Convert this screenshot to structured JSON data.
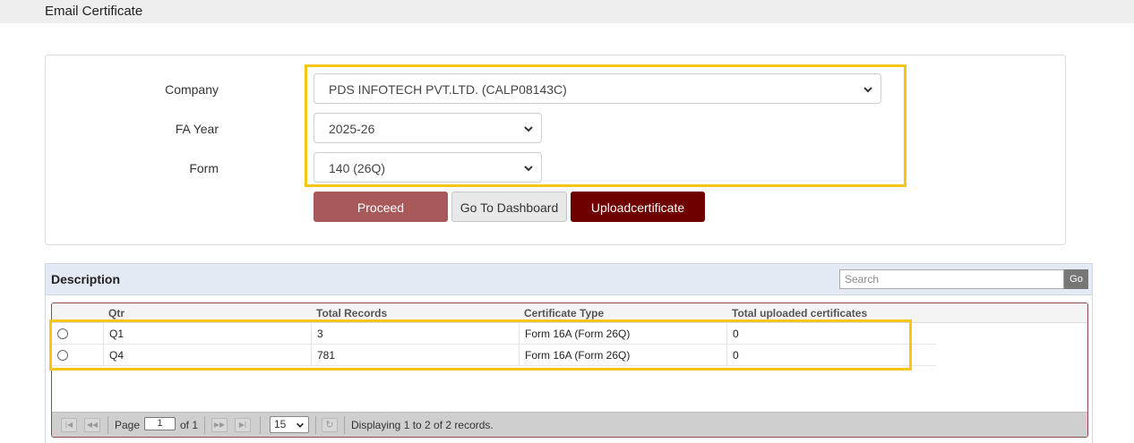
{
  "page": {
    "title": "Email Certificate"
  },
  "form": {
    "company_label": "Company",
    "company_value": "PDS INFOTECH PVT.LTD. (CALP08143C)",
    "fa_year_label": "FA Year",
    "fa_year_value": "2025-26",
    "form_label": "Form",
    "form_value": "140 (26Q)"
  },
  "buttons": {
    "proceed": "Proceed",
    "dashboard": "Go To Dashboard",
    "upload": "Uploadcertificate"
  },
  "grid": {
    "caption": "Description",
    "search_placeholder": "Search",
    "go_label": "Go",
    "columns": [
      "Qtr",
      "Total Records",
      "Certificate Type",
      "Total uploaded certificates"
    ],
    "rows": [
      {
        "qtr": "Q1",
        "total_records": "3",
        "certificate_type": "Form 16A (Form 26Q)",
        "uploaded": "0"
      },
      {
        "qtr": "Q4",
        "total_records": "781",
        "certificate_type": "Form 16A (Form 26Q)",
        "uploaded": "0"
      }
    ]
  },
  "pager": {
    "page_label": "Page",
    "current_page": "1",
    "of_label": "of 1",
    "page_size": "15",
    "status": "Displaying 1 to 2 of 2 records."
  },
  "colors": {
    "highlight": "#f5c518",
    "proceed": "#a85a5a",
    "upload": "#6e0000",
    "grid_header": "#e3eaf4"
  },
  "icons": [
    "chevron-down-icon",
    "first-page-icon",
    "prev-page-icon",
    "next-page-icon",
    "last-page-icon",
    "refresh-icon"
  ]
}
